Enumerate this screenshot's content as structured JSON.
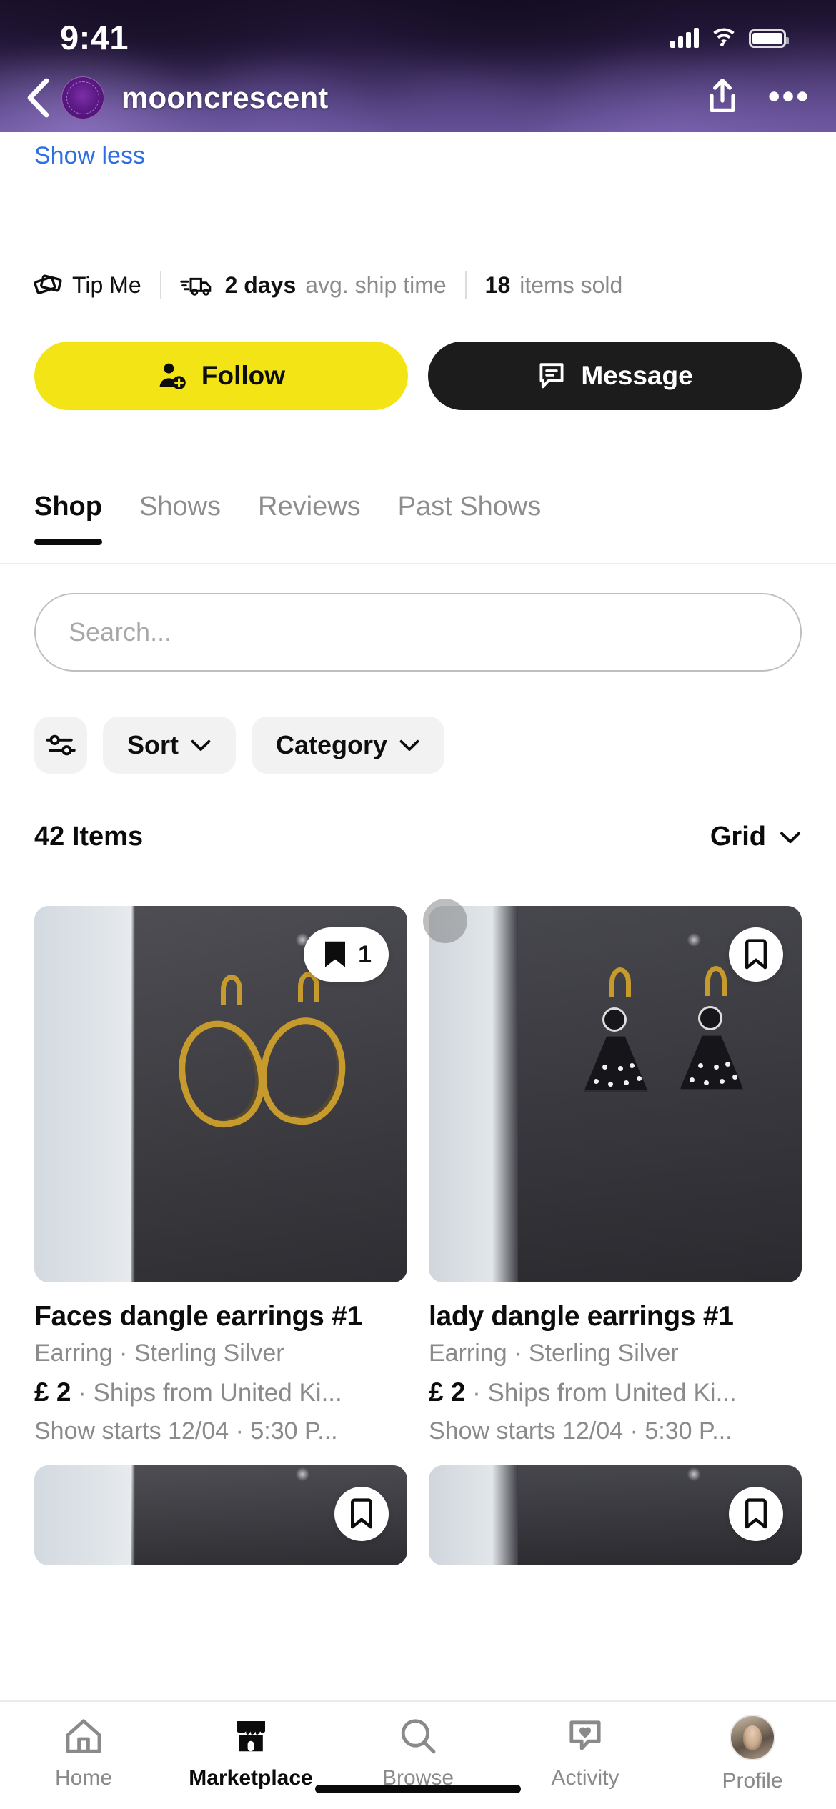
{
  "status_bar": {
    "time": "9:41",
    "cellular_icon": "signal-bars-icon",
    "wifi_icon": "wifi-icon",
    "battery_icon": "battery-icon"
  },
  "header": {
    "back_icon": "back-chevron-icon",
    "avatar_icon": "shop-avatar",
    "shop_name": "mooncrescent",
    "share_icon": "share-icon",
    "more_icon": "more-options-icon"
  },
  "profile": {
    "show_less_label": "Show less",
    "stats": [
      {
        "icon": "tip-money-icon",
        "label": "Tip Me",
        "value": "",
        "suffix": ""
      },
      {
        "icon": "shipping-truck-icon",
        "value": "2 days",
        "suffix": "avg. ship time"
      },
      {
        "icon": "",
        "value": "18",
        "suffix": "items sold"
      }
    ],
    "follow_button": {
      "label": "Follow",
      "icon": "person-add-icon",
      "color": "#F3E515"
    },
    "message_button": {
      "label": "Message",
      "icon": "chat-bubble-icon",
      "color": "#1C1C1C"
    }
  },
  "tabs": [
    {
      "label": "Shop",
      "active": true
    },
    {
      "label": "Shows",
      "active": false
    },
    {
      "label": "Reviews",
      "active": false
    },
    {
      "label": "Past Shows",
      "active": false
    }
  ],
  "search": {
    "placeholder": "Search...",
    "value": "",
    "icon": "search-input"
  },
  "filters": [
    {
      "label": "",
      "icon": "filter-sliders-icon"
    },
    {
      "label": "Sort",
      "icon": "chevron-down-icon"
    },
    {
      "label": "Category",
      "icon": "chevron-down-icon"
    }
  ],
  "items_header": {
    "count_label": "42 Items",
    "view_mode": "Grid",
    "view_icon": "chevron-down-icon"
  },
  "products": [
    {
      "title": "Faces dangle earrings #1",
      "meta": "Earring · Sterling Silver",
      "price": "£ 2",
      "price_suffix": "· Ships from United Ki...",
      "show_time": "Show starts 12/04 · 5:30 P...",
      "bookmark_icon": "bookmark-filled-icon",
      "bookmark_count": "1",
      "bookmarked": true
    },
    {
      "title": "lady dangle earrings #1",
      "meta": "Earring · Sterling Silver",
      "price": "£ 2",
      "price_suffix": "· Ships from United Ki...",
      "show_time": "Show starts 12/04 · 5:30 P...",
      "bookmark_icon": "bookmark-outline-icon",
      "bookmark_count": "",
      "bookmarked": false
    }
  ],
  "bottom_nav": [
    {
      "label": "Home",
      "icon": "home-icon",
      "active": false
    },
    {
      "label": "Marketplace",
      "icon": "marketplace-storefront-icon",
      "active": true
    },
    {
      "label": "Browse",
      "icon": "search-magnifier-icon",
      "active": false
    },
    {
      "label": "Activity",
      "icon": "activity-heart-bubble-icon",
      "active": false
    },
    {
      "label": "Profile",
      "icon": "profile-avatar-icon",
      "active": false
    }
  ]
}
